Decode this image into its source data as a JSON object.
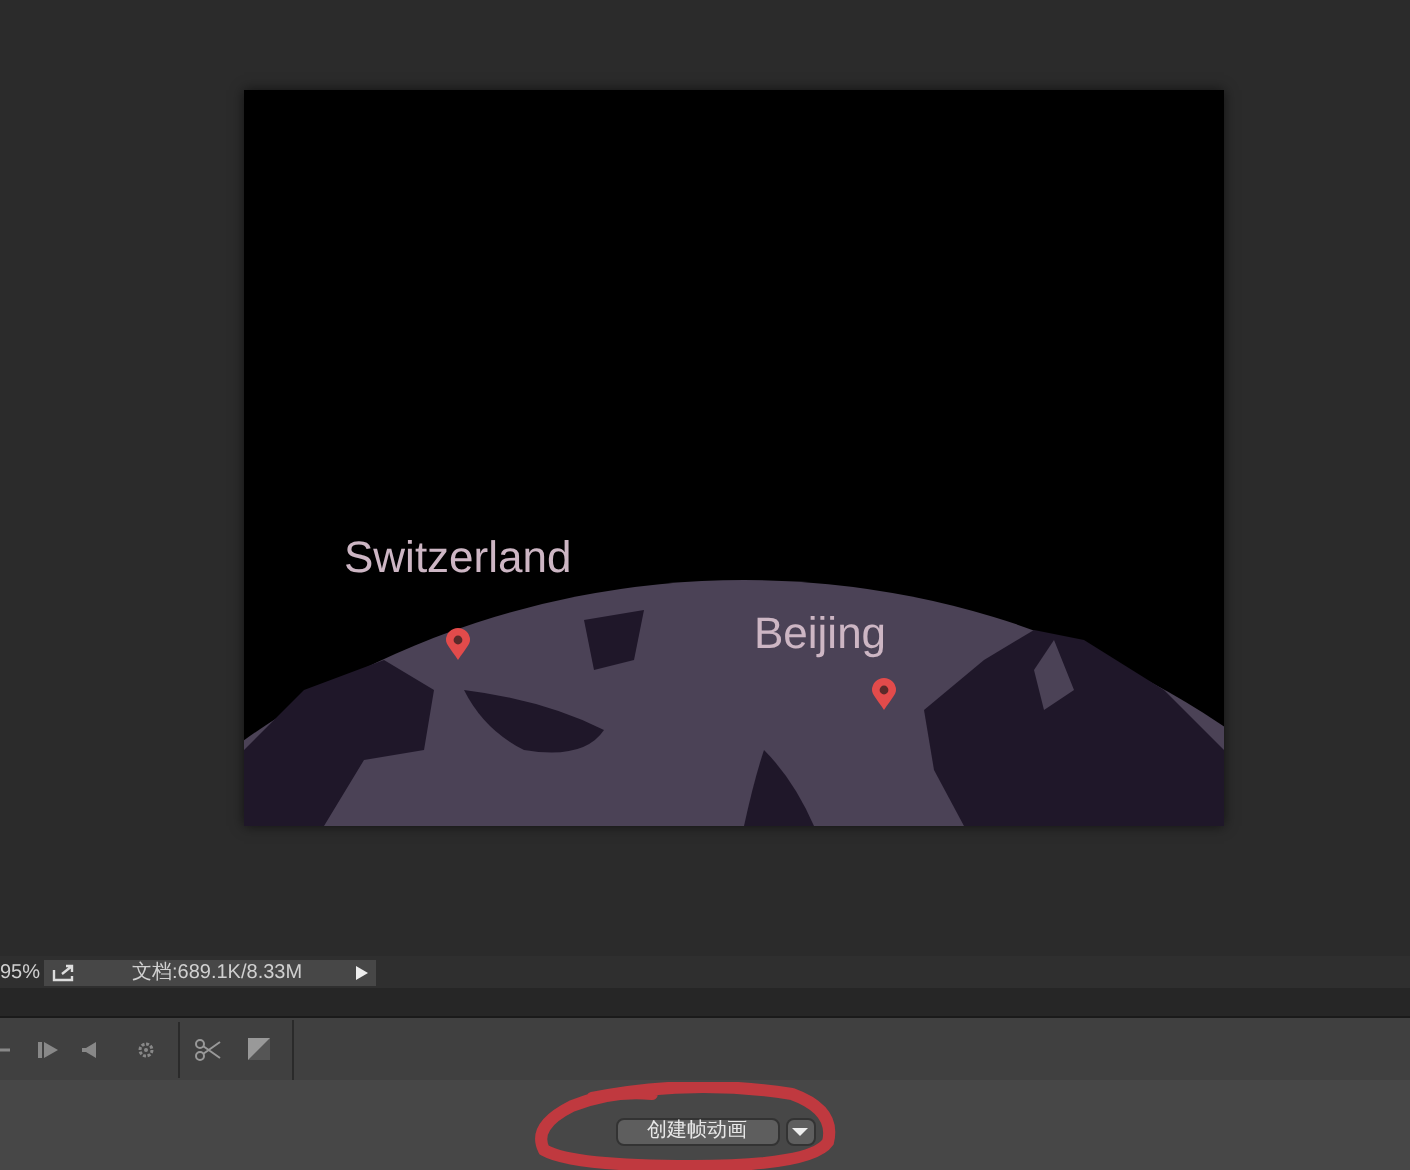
{
  "canvas": {
    "labels": [
      "Switzerland",
      "Beijing"
    ]
  },
  "status_bar": {
    "zoom": "95%",
    "doc_info": "文档:689.1K/8.33M"
  },
  "timeline": {
    "create_button": "创建帧动画"
  }
}
